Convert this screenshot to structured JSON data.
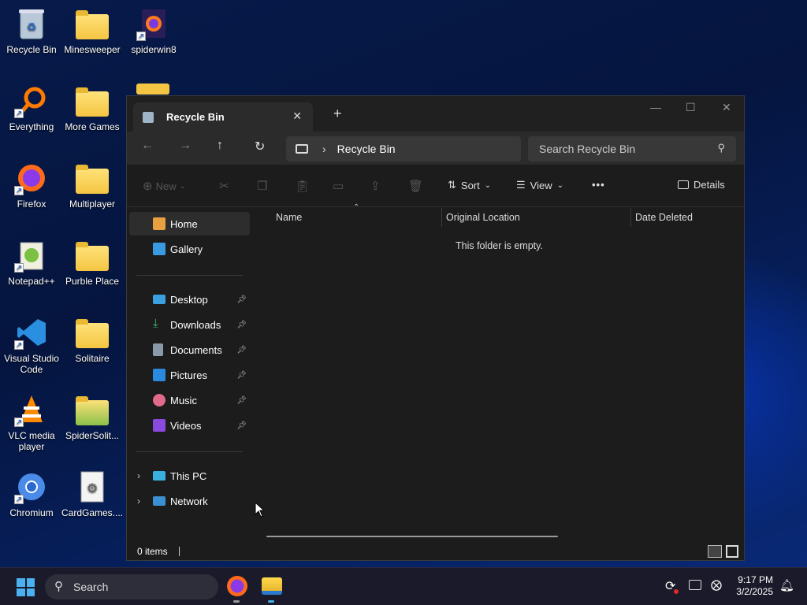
{
  "desktop": {
    "icons": [
      {
        "label": "Recycle Bin",
        "icon": "recycle-bin-icon"
      },
      {
        "label": "Minesweeper",
        "icon": "folder-icon"
      },
      {
        "label": "spiderwin8",
        "icon": "firefox-icon"
      },
      {
        "label": "Everything",
        "icon": "everything-icon"
      },
      {
        "label": "More Games",
        "icon": "folder-icon"
      },
      {
        "label": "Firefox",
        "icon": "firefox-icon"
      },
      {
        "label": "Multiplayer",
        "icon": "folder-icon"
      },
      {
        "label": "Notepad++",
        "icon": "notepadpp-icon"
      },
      {
        "label": "Purble Place",
        "icon": "folder-icon"
      },
      {
        "label": "Visual Studio Code",
        "icon": "vscode-icon"
      },
      {
        "label": "Solitaire",
        "icon": "folder-icon"
      },
      {
        "label": "VLC media player",
        "icon": "vlc-icon"
      },
      {
        "label": "SpiderSolit...",
        "icon": "folder-icon"
      },
      {
        "label": "Chromium",
        "icon": "chromium-icon"
      },
      {
        "label": "CardGames....",
        "icon": "settings-file-icon"
      }
    ]
  },
  "window": {
    "tab_title": "Recycle Bin",
    "new_tab": "+",
    "breadcrumb": "Recycle Bin",
    "search_placeholder": "Search Recycle Bin",
    "toolbar": {
      "new": "New",
      "sort": "Sort",
      "view": "View",
      "more": "•••",
      "details": "Details"
    },
    "nav": {
      "home": "Home",
      "gallery": "Gallery",
      "quick": [
        "Desktop",
        "Downloads",
        "Documents",
        "Pictures",
        "Music",
        "Videos"
      ],
      "this_pc": "This PC",
      "network": "Network"
    },
    "columns": [
      "Name",
      "Original Location",
      "Date Deleted"
    ],
    "empty_message": "This folder is empty.",
    "status": "0 items"
  },
  "taskbar": {
    "search": "Search",
    "time": "9:17 PM",
    "date": "3/2/2025"
  }
}
